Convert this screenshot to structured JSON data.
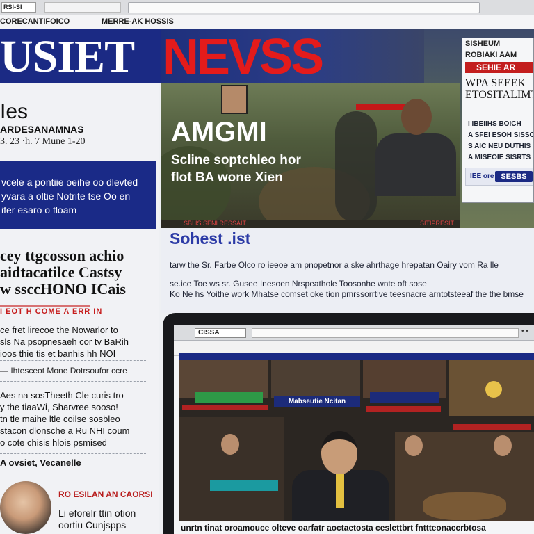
{
  "browser": {
    "tab_label": "RSI-SI"
  },
  "navbar": {
    "item1": "CORECANTIFOICO",
    "item2": "MERRE-AK HOSSIS"
  },
  "masthead": {
    "left": "USIET",
    "right": "NEVSS"
  },
  "left": {
    "heading1": "Ies",
    "heading2": "ARDESANAMNAS",
    "date": "3. 23 ·h. 7 Mune 1-20",
    "box_lines": [
      "vcele a pontiie oeihe oo dlevted",
      "yvara a oltie Notrite tse Oo en",
      "ifer esaro o floam —"
    ],
    "story_lines": [
      "cey ttgcosson achio",
      "aidtacatilce Castsy",
      "w ssccHONO ICais"
    ],
    "red_label": "I EOT H  COME A ERR IN",
    "para1": [
      "ce fret lirecoe the Nowarlor to",
      "sls Na psopnesaeh cor tv BaRih",
      "ioos thie tis et banhis hh NOI"
    ],
    "note": "— Ihtesceot Mone Dotrsoufor ccre",
    "para3": [
      "Aes na sosTheeth Cle curis tro",
      "y the tiaaWi, Sharvree sooso!",
      "tn tle maihe ltle coilse sosbleo",
      "stacon dlonsche a Ru NHI coum",
      "o cote chisis hlois psmised"
    ],
    "byline": "A ovsiet, Vecanelle",
    "bottom_red": "RO ESILAN AN CAORSI",
    "bottom_lines": [
      "Li eforelr ttin otion",
      "oortiu Cunjspps"
    ]
  },
  "hero": {
    "title": "AMGMI",
    "sub_lines": [
      "Scline soptchleo hor",
      "flot BA wone Xien"
    ],
    "ticker_left": "SBI IS SENI RESSAIT",
    "ticker_right": "SITIPRESIT"
  },
  "side": {
    "row1": "SISHEUM",
    "row2": "ROBIAKI AAM",
    "red": "SEHIE AR",
    "big_lines": [
      "WPA SEEEK",
      "ETOSITALIMT"
    ],
    "small_lines": [
      "I IBEIIHS BOICH",
      "A SFEI ESOH SISSO",
      "S AIC NEU DUTHIS",
      "A MISEOIE SISRTS"
    ],
    "btn_small": "IEE ore",
    "btn": "SESBS"
  },
  "section": {
    "title": "Sohest .ist",
    "lines": [
      "tarw the Sr. Farbe Olco   ro  ieeoe am pnopetnor a ske ahrthage hrepatan  Oairy vom Ra lle",
      "se.ice Toe ws sr. Gusee Inesoen Nrspeathole Toosonhe wnte oft sose",
      "Ko Ne hs Yoithe work Mhatse comset oke tion pmrssorrtive teesnacre arntotsteeaf the the bmse"
    ]
  },
  "tablet": {
    "tab_label": "CISSA",
    "dots": "• •",
    "banner1": "Mabseutie Ncitan",
    "bottom_caption": "unrtn tinat oroamouce olteve oarfatr aoctaetosta ceslettbrt fnttteonaccrbtosa"
  }
}
